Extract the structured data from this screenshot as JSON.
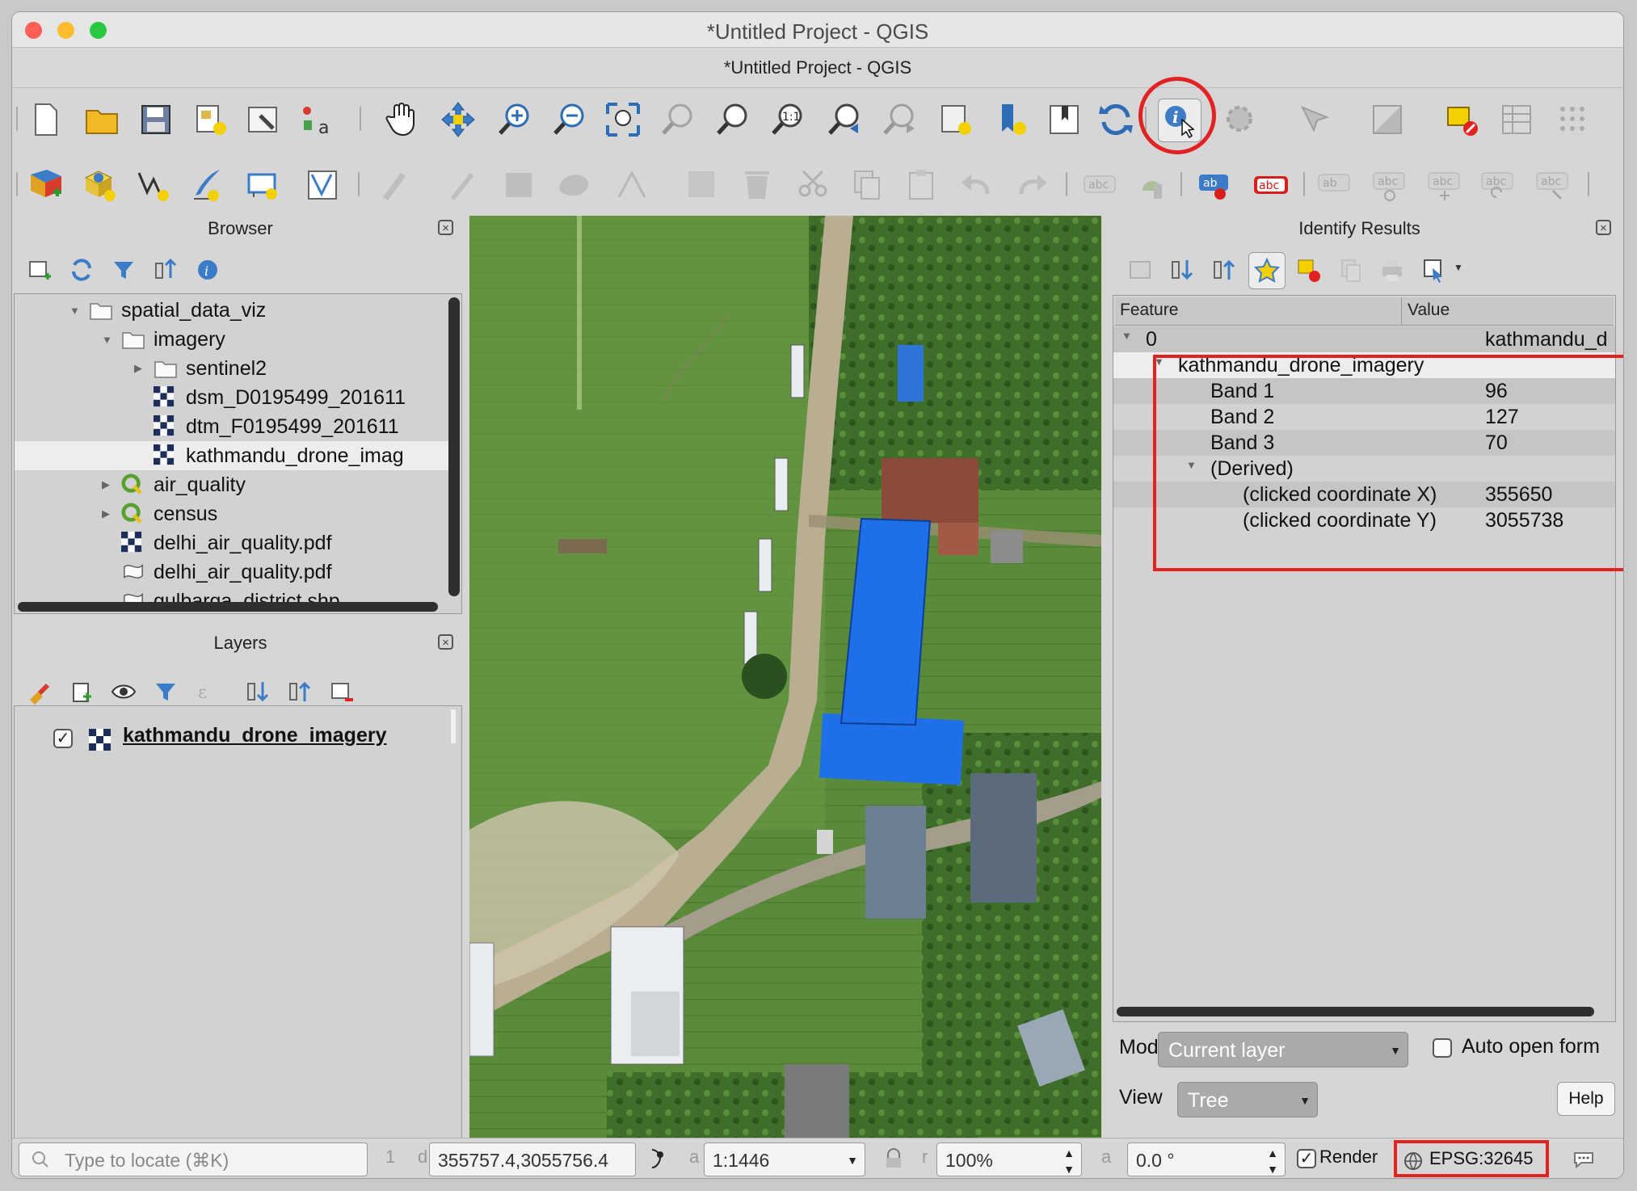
{
  "window": {
    "title": "*Untitled Project - QGIS",
    "subtitle": "*Untitled Project - QGIS"
  },
  "toolbar_row1": [
    {
      "name": "new-project-icon"
    },
    {
      "name": "open-project-icon"
    },
    {
      "name": "save-project-icon"
    },
    {
      "name": "new-print-layout-icon"
    },
    {
      "name": "style-manager-icon"
    },
    {
      "name": "map-tips-icon"
    },
    {
      "name": "pan-map-icon"
    },
    {
      "name": "pan-to-selection-icon"
    },
    {
      "name": "zoom-in-icon"
    },
    {
      "name": "zoom-out-icon"
    },
    {
      "name": "zoom-full-icon"
    },
    {
      "name": "zoom-to-selection-icon"
    },
    {
      "name": "zoom-to-layer-icon"
    },
    {
      "name": "zoom-native-resolution-icon"
    },
    {
      "name": "zoom-last-icon"
    },
    {
      "name": "zoom-next-icon"
    },
    {
      "name": "new-map-view-icon"
    },
    {
      "name": "new-bookmark-icon"
    },
    {
      "name": "show-bookmarks-icon"
    },
    {
      "name": "refresh-icon"
    },
    {
      "name": "identify-features-icon"
    },
    {
      "name": "actions-icon"
    },
    {
      "name": "select-features-icon"
    },
    {
      "name": "select-by-expression-icon"
    },
    {
      "name": "deselect-features-icon"
    },
    {
      "name": "attribute-table-icon"
    },
    {
      "name": "field-calculator-icon"
    }
  ],
  "toolbar_row2": [
    {
      "name": "data-source-manager-icon"
    },
    {
      "name": "new-geopackage-layer-icon"
    },
    {
      "name": "new-shapefile-layer-icon"
    },
    {
      "name": "new-temporary-layer-icon"
    },
    {
      "name": "new-virtual-layer-icon"
    },
    {
      "name": "digitize-icon"
    },
    {
      "name": "current-edits-icon"
    },
    {
      "name": "toggle-editing-icon"
    },
    {
      "name": "save-edits-icon"
    },
    {
      "name": "add-polygon-icon"
    },
    {
      "name": "vertex-tool-icon"
    },
    {
      "name": "modify-attributes-icon"
    },
    {
      "name": "delete-selected-icon"
    },
    {
      "name": "cut-features-icon"
    },
    {
      "name": "copy-features-icon"
    },
    {
      "name": "paste-features-icon"
    },
    {
      "name": "undo-icon"
    },
    {
      "name": "redo-icon"
    },
    {
      "name": "label-tool-icon"
    },
    {
      "name": "diagram-tool-icon"
    },
    {
      "name": "highlight-pinned-label-icon"
    },
    {
      "name": "pin-label-icon"
    },
    {
      "name": "show-hide-label-icon"
    },
    {
      "name": "move-label-icon"
    },
    {
      "name": "rotate-label-icon"
    },
    {
      "name": "change-label-icon"
    }
  ],
  "browser": {
    "title": "Browser",
    "items": [
      {
        "label": "spatial_data_viz",
        "icon": "folder-icon",
        "indent": 0,
        "arrow": "▼"
      },
      {
        "label": "imagery",
        "icon": "folder-icon",
        "indent": 1,
        "arrow": "▼"
      },
      {
        "label": "sentinel2",
        "icon": "folder-icon",
        "indent": 2,
        "arrow": "▶"
      },
      {
        "label": "dsm_D0195499_201611",
        "icon": "raster-icon",
        "indent": 2,
        "arrow": ""
      },
      {
        "label": "dtm_F0195499_201611",
        "icon": "raster-icon",
        "indent": 2,
        "arrow": ""
      },
      {
        "label": "kathmandu_drone_imag",
        "icon": "raster-icon",
        "indent": 2,
        "arrow": "",
        "selected": true
      },
      {
        "label": "air_quality",
        "icon": "qgis-project-icon",
        "indent": 1,
        "arrow": "▶"
      },
      {
        "label": "census",
        "icon": "qgis-project-icon",
        "indent": 1,
        "arrow": "▶"
      },
      {
        "label": "delhi_air_quality.pdf",
        "icon": "raster-icon",
        "indent": 1,
        "arrow": ""
      },
      {
        "label": "delhi_air_quality.pdf",
        "icon": "vector-icon",
        "indent": 1,
        "arrow": ""
      },
      {
        "label": "gulbarga_district.shp",
        "icon": "vector-icon",
        "indent": 1,
        "arrow": ""
      }
    ]
  },
  "layers": {
    "title": "Layers",
    "items": [
      {
        "label": "kathmandu_drone_imagery",
        "checked": true
      }
    ]
  },
  "identify": {
    "title": "Identify Results",
    "col_feature": "Feature",
    "col_value": "Value",
    "rows": [
      {
        "feature": "0",
        "value": "kathmandu_d",
        "indent": 0,
        "arrow": "▼"
      },
      {
        "feature": "kathmandu_drone_imagery",
        "value": "",
        "indent": 1,
        "arrow": "▼"
      },
      {
        "feature": "Band 1",
        "value": "96",
        "indent": 2,
        "arrow": ""
      },
      {
        "feature": "Band 2",
        "value": "127",
        "indent": 2,
        "arrow": ""
      },
      {
        "feature": "Band 3",
        "value": "70",
        "indent": 2,
        "arrow": ""
      },
      {
        "feature": "(Derived)",
        "value": "",
        "indent": 2,
        "arrow": "▼"
      },
      {
        "feature": "(clicked coordinate X)",
        "value": "355650",
        "indent": 3,
        "arrow": ""
      },
      {
        "feature": "(clicked coordinate Y)",
        "value": "3055738",
        "indent": 3,
        "arrow": ""
      }
    ],
    "mode_label": "Mode",
    "mode_value": "Current layer",
    "auto_open_label": "Auto open form",
    "view_label": "View",
    "view_value": "Tree",
    "help_label": "Help"
  },
  "status": {
    "locator_placeholder": "Type to locate (⌘K)",
    "coordinate_value": "355757.4,3055756.4",
    "scale_value": "1:1446",
    "magnifier_value": "100%",
    "rotation_value": "0.0 °",
    "render_label": "Render",
    "crs_label": "EPSG:32645",
    "frag_1": "1",
    "frag_d": "d",
    "frag_a": "a",
    "frag_r": "r",
    "frag_a2": "a"
  }
}
